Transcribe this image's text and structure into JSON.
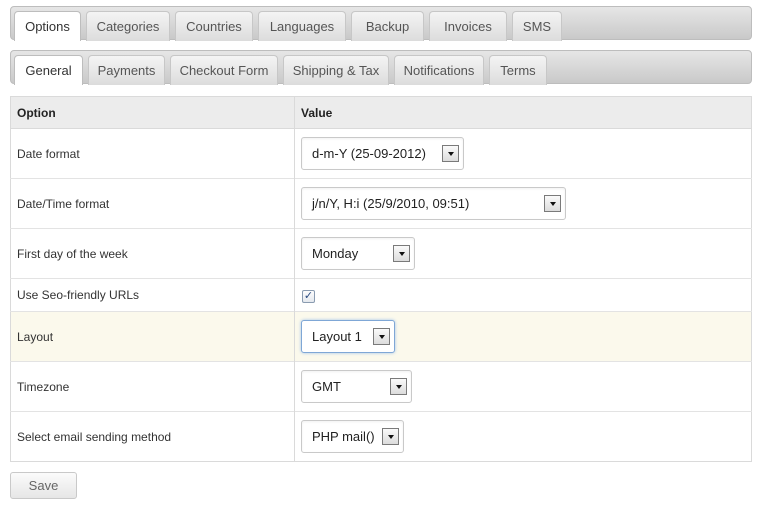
{
  "main_tabs": [
    "Options",
    "Categories",
    "Countries",
    "Languages",
    "Backup",
    "Invoices",
    "SMS"
  ],
  "sub_tabs": [
    "General",
    "Payments",
    "Checkout Form",
    "Shipping & Tax",
    "Notifications",
    "Terms"
  ],
  "table": {
    "header_option": "Option",
    "header_value": "Value",
    "rows": [
      {
        "label": "Date format",
        "value": "d-m-Y (25-09-2012)"
      },
      {
        "label": "Date/Time format",
        "value": "j/n/Y, H:i (25/9/2010, 09:51)"
      },
      {
        "label": "First day of the week",
        "value": "Monday"
      },
      {
        "label": "Use Seo-friendly URLs",
        "checked": true,
        "check_glyph": "✓"
      },
      {
        "label": "Layout",
        "value": "Layout 1"
      },
      {
        "label": "Timezone",
        "value": "GMT"
      },
      {
        "label": "Select email sending method",
        "value": "PHP mail()"
      }
    ]
  },
  "save_label": "Save",
  "colors": {
    "highlight_row": "#fbf9ec",
    "header_bg": "#ececec",
    "focus_border": "#7fa7d6"
  }
}
